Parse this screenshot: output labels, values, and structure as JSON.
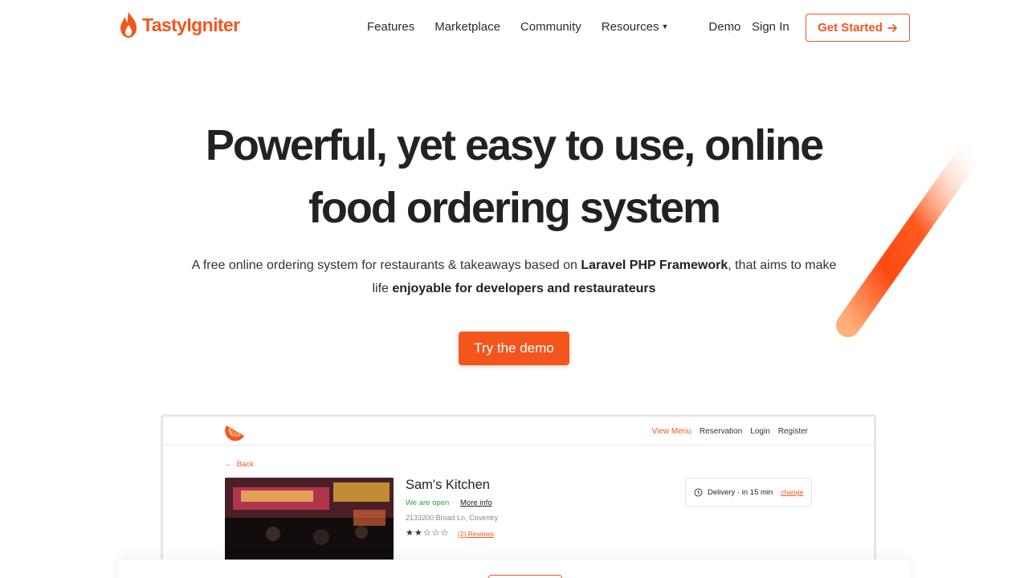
{
  "brand": {
    "name": "TastyIgniter",
    "accent": "#f2561d"
  },
  "nav": {
    "links": [
      "Features",
      "Marketplace",
      "Community",
      "Resources",
      "Demo"
    ],
    "signin": "Sign In",
    "cta": "Get Started"
  },
  "hero": {
    "title_line1": "Powerful, yet easy to use, online",
    "title_line2": "food ordering system",
    "subtitle_part1": "A free online ordering system for restaurants & takeaways based on ",
    "subtitle_bold1": "Laravel PHP Framework",
    "subtitle_part2": ", that aims to make life ",
    "subtitle_bold2": "enjoyable for developers and restaurateurs",
    "demo_button": "Try the demo"
  },
  "preview": {
    "nav_links": [
      "View Menu",
      "Reservation",
      "Login",
      "Register"
    ],
    "back": "Back",
    "restaurant_name": "Sam's Kitchen",
    "status": "We are open",
    "more_info": "More info",
    "address": "2133200 Broad Ln, Coventry",
    "rating": 2,
    "rating_max": 5,
    "reviews": "(2) Reviews",
    "delivery_text": "Delivery · in 15 min",
    "delivery_change": "change"
  }
}
